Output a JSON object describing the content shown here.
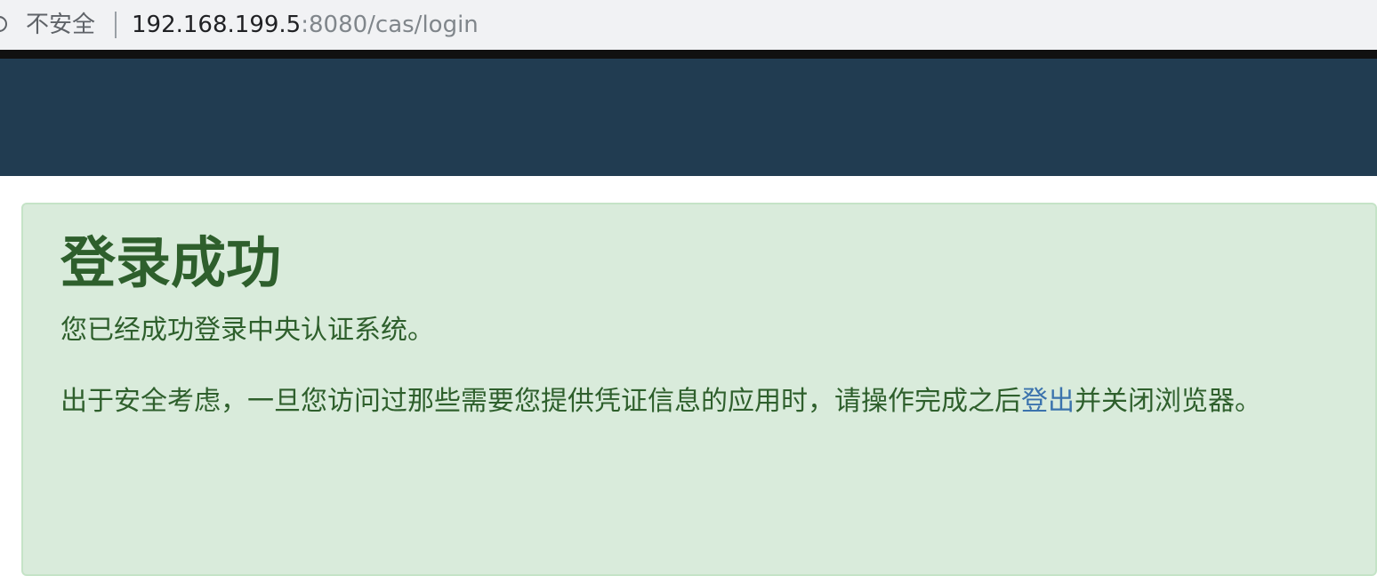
{
  "browser": {
    "security_label": "不安全",
    "url_host": "192.168.199.5",
    "url_rest": ":8080/cas/login"
  },
  "colors": {
    "header": "#213c51",
    "panel_bg": "#d9ebdb",
    "text_green": "#2e5f2c",
    "link_blue": "#3b73ad"
  },
  "main": {
    "title": "登录成功",
    "message": "您已经成功登录中央认证系统。",
    "security_prefix": "出于安全考虑，一旦您访问过那些需要您提供凭证信息的应用时，请操作完成之后",
    "logout_label": "登出",
    "security_suffix": "并关闭浏览器。"
  }
}
